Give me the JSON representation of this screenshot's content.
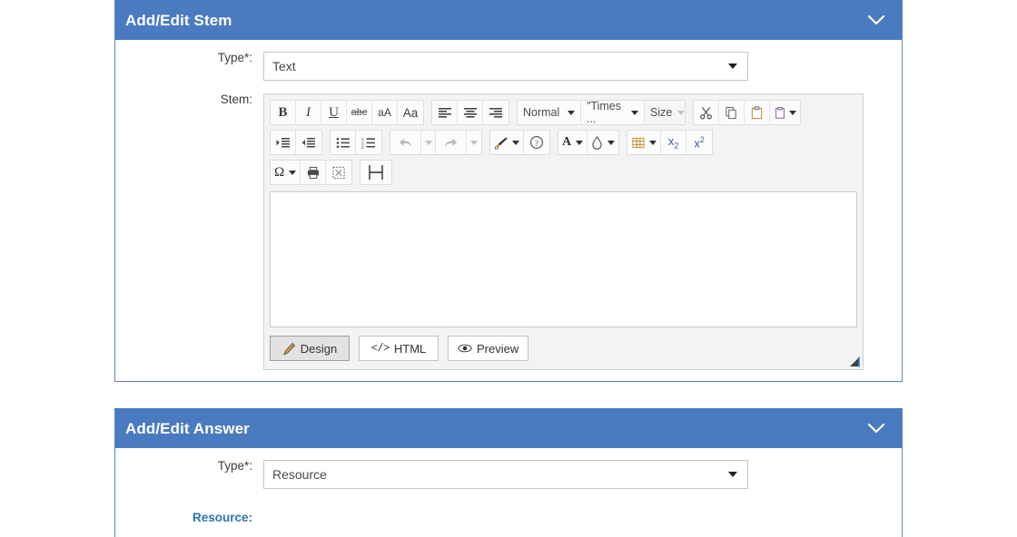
{
  "colors": {
    "header_blue": "#4a7ac0",
    "panel_border": "#5b84c4",
    "link_blue": "#2e74b5",
    "toolbar_bg": "#f3f3f3"
  },
  "panels": [
    {
      "id": "stem",
      "title": "Add/Edit Stem",
      "collapse_icon": "chevron-down-icon",
      "type_field": {
        "label": "Type*:",
        "value": "Text",
        "arrow_icon": "triangle-down-icon"
      },
      "stem_field": {
        "label": "Stem:"
      }
    },
    {
      "id": "answer",
      "title": "Add/Edit Answer",
      "collapse_icon": "chevron-down-icon",
      "type_field": {
        "label": "Type*:",
        "value": "Resource",
        "arrow_icon": "triangle-down-icon"
      },
      "resource_field": {
        "label": "Resource:"
      }
    }
  ],
  "editor": {
    "toolbar_rows": [
      {
        "groups": [
          {
            "buttons": [
              {
                "name": "bold-icon",
                "glyph": "B",
                "style": "b-b"
              },
              {
                "name": "italic-icon",
                "glyph": "I",
                "style": "b-i"
              },
              {
                "name": "underline-icon",
                "glyph": "U",
                "style": "b-u"
              },
              {
                "name": "strikethrough-icon",
                "glyph": "abc",
                "style": "b-s"
              },
              {
                "name": "decrease-font-size-icon",
                "glyph": "aA",
                "style": "b-aa-small"
              },
              {
                "name": "increase-font-size-icon",
                "glyph": "Aa",
                "style": "b-aa-large"
              }
            ]
          },
          {
            "buttons": [
              {
                "name": "align-left-icon",
                "glyph": "",
                "style": "svg-align-left"
              },
              {
                "name": "align-center-icon",
                "glyph": "",
                "style": "svg-align-center"
              },
              {
                "name": "align-right-icon",
                "glyph": "",
                "style": "svg-align-right"
              }
            ]
          },
          {
            "buttons": [
              {
                "name": "paragraph-format-select",
                "glyph": "Normal",
                "style": "combo"
              },
              {
                "name": "font-family-select",
                "glyph": "\"Times ...",
                "style": "combo"
              },
              {
                "name": "font-size-select",
                "glyph": "Size",
                "style": "combo-disabled"
              }
            ]
          },
          {
            "buttons": [
              {
                "name": "cut-icon",
                "glyph": "",
                "style": "svg-cut"
              },
              {
                "name": "copy-icon",
                "glyph": "",
                "style": "svg-copy"
              },
              {
                "name": "paste-icon",
                "glyph": "",
                "style": "svg-paste"
              },
              {
                "name": "paste-options-icon",
                "glyph": "",
                "style": "svg-paste-menu"
              }
            ]
          }
        ]
      },
      {
        "groups": [
          {
            "buttons": [
              {
                "name": "indent-icon",
                "glyph": "",
                "style": "svg-indent"
              },
              {
                "name": "outdent-icon",
                "glyph": "",
                "style": "svg-outdent"
              }
            ]
          },
          {
            "buttons": [
              {
                "name": "bulleted-list-icon",
                "glyph": "",
                "style": "svg-ul"
              },
              {
                "name": "numbered-list-icon",
                "glyph": "",
                "style": "svg-ol"
              }
            ]
          },
          {
            "buttons": [
              {
                "name": "undo-icon",
                "glyph": "",
                "style": "svg-undo-disabled"
              },
              {
                "name": "redo-icon",
                "glyph": "",
                "style": "svg-redo-disabled"
              }
            ]
          },
          {
            "buttons": [
              {
                "name": "format-painter-icon",
                "glyph": "",
                "style": "svg-painter"
              },
              {
                "name": "help-icon",
                "glyph": "?",
                "style": "svg-help"
              }
            ]
          },
          {
            "buttons": [
              {
                "name": "font-color-icon",
                "glyph": "A",
                "style": "svg-fontcolor"
              },
              {
                "name": "highlight-color-icon",
                "glyph": "",
                "style": "svg-highlight"
              }
            ]
          },
          {
            "buttons": [
              {
                "name": "insert-table-icon",
                "glyph": "",
                "style": "svg-table"
              },
              {
                "name": "subscript-icon",
                "glyph": "x2",
                "style": "sub"
              },
              {
                "name": "superscript-icon",
                "glyph": "x2",
                "style": "sup"
              }
            ]
          }
        ]
      },
      {
        "groups": [
          {
            "buttons": [
              {
                "name": "special-character-icon",
                "glyph": "Ω",
                "style": "omega"
              },
              {
                "name": "print-icon",
                "glyph": "",
                "style": "svg-print"
              },
              {
                "name": "select-all-icon",
                "glyph": "",
                "style": "svg-selectall"
              }
            ]
          },
          {
            "buttons": [
              {
                "name": "page-break-icon",
                "glyph": "",
                "style": "svg-pagebreak"
              }
            ]
          }
        ]
      }
    ],
    "content_value": "",
    "tabs": [
      {
        "label": "Design",
        "icon": "pencil-icon",
        "active": true
      },
      {
        "label": "HTML",
        "icon": "code-icon",
        "active": false
      },
      {
        "label": "Preview",
        "icon": "eye-icon",
        "active": false
      }
    ],
    "resize_grip": "resize-grip-icon"
  }
}
